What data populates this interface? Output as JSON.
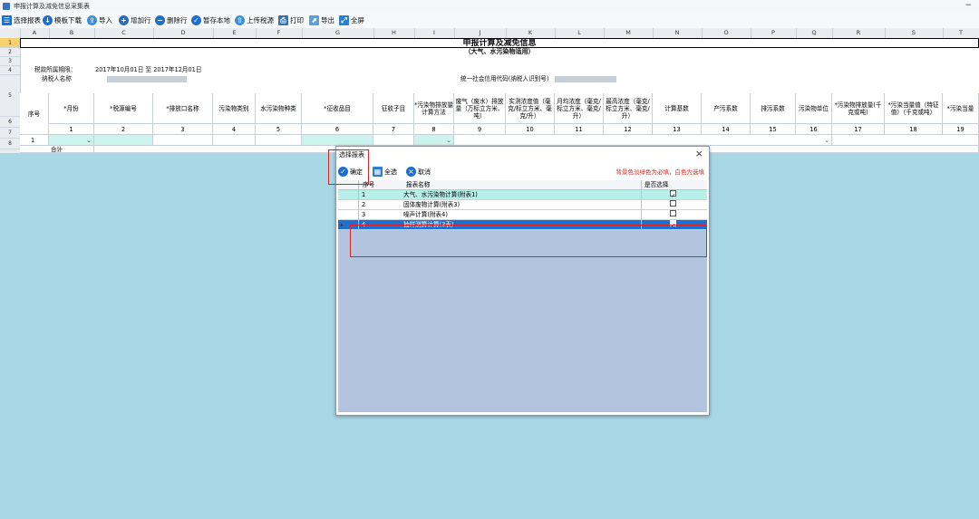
{
  "window": {
    "title": "申报计算及减免信息采集表",
    "minimize": "−"
  },
  "toolbar": {
    "select_report": "选择报表",
    "template_download": "模板下载",
    "import": "导入",
    "add_row": "增加行",
    "delete_row": "删除行",
    "save_local": "暂存本地",
    "upload": "上传税源",
    "print": "打印",
    "export": "导出",
    "fullscreen": "全屏"
  },
  "sheet": {
    "col_letters": [
      "A",
      "B",
      "C",
      "D",
      "E",
      "F",
      "G",
      "H",
      "I",
      "J",
      "K",
      "L",
      "M",
      "N",
      "O",
      "P",
      "Q",
      "R",
      "S",
      "T"
    ],
    "row_numbers": [
      "1",
      "2",
      "3",
      "4",
      "5",
      "6",
      "7",
      "8"
    ],
    "title": "申报计算及减免信息",
    "subtitle": "（大气、水污染物适用）",
    "period_label": "税款所属期限：",
    "period_value": "2017年10月01日 至 2017年12月01日",
    "taxpayer_label": "纳税人名称",
    "credit_code_label": "统一社会信用代码(纳税人识别号)",
    "headers": [
      "序号",
      "*月份",
      "*税源编号",
      "*排放口名称",
      "污染物类别",
      "水污染物种类",
      "*征收品目",
      "征收子目",
      "*污染物排放量计算方法",
      "废气（废水）排放量（万标立方米、吨）",
      "实测浓度值（毫克/标立方米、毫克/升）",
      "月均浓度（毫克/标立方米、毫克/升）",
      "最高浓度（毫克/标立方米、毫克/升）",
      "计算基数",
      "产污系数",
      "排污系数",
      "污染物单位",
      "*污染物排放量(千克或吨)",
      "*污染当量值（特征值）（千克或吨）",
      "*污染当量"
    ],
    "numbers": [
      "1",
      "2",
      "3",
      "4",
      "5",
      "6",
      "7",
      "8",
      "9",
      "10",
      "11",
      "12",
      "13",
      "14",
      "15",
      "16",
      "17",
      "18",
      "19"
    ],
    "row7_index": "1",
    "total_label": "合计"
  },
  "dialog": {
    "title": "选择报表",
    "close": "×",
    "confirm": "确定",
    "select_all": "全选",
    "cancel": "取消",
    "hint": "背景色淡绿色为必填，白色为选填",
    "col_index": "序号",
    "col_name": "报表名称",
    "col_select": "是否选择",
    "rows": [
      {
        "index": "1",
        "name": "大气、水污染物计算(附表1)",
        "checked": true
      },
      {
        "index": "2",
        "name": "固体废物计算(附表3)",
        "checked": false
      },
      {
        "index": "3",
        "name": "噪声计算(附表4)",
        "checked": false
      },
      {
        "index": "4",
        "name": "抽样测算计算(3表)",
        "checked": true
      }
    ]
  },
  "colors": {
    "accent": "#1a6fd1",
    "selected_row": "#1e6fcf",
    "required_row": "#b7efe9",
    "highlight_box": "#e32020",
    "background": "#a8d8e6"
  }
}
